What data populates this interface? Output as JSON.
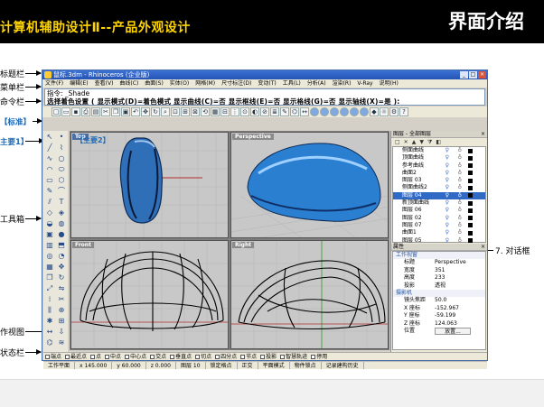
{
  "slide": {
    "header_left": "计算机辅助设计Ⅱ--产品外观设计",
    "header_right": "界面介绍"
  },
  "callouts": {
    "titlebar": "标题栏",
    "menubar": "菜单栏",
    "command": "命令栏",
    "standard": "【标准】",
    "main1": "主要1】",
    "main2": "【主要2】",
    "toolbox": "工具箱",
    "workview": "作视图",
    "statusbar": "状态栏",
    "dialog": "7.  对话框"
  },
  "app": {
    "title": "鼠标.3dm - Rhinoceros (企业版)",
    "menu": [
      "文件(F)",
      "编辑(E)",
      "查看(V)",
      "曲线(C)",
      "曲面(S)",
      "实体(O)",
      "网格(M)",
      "尺寸标注(D)",
      "变动(T)",
      "工具(L)",
      "分析(A)",
      "渲染(R)",
      "V-Ray",
      "说明(H)"
    ],
    "command_line1": "指令: _Shade",
    "command_line2": "选择着色设置 ( 显示模式(D)=着色模式  显示曲线(C)=否  显示框线(E)=否  显示格线(G)=否  显示轴线(X)=是 ):"
  },
  "viewports": {
    "top": "Top",
    "perspective": "Perspective",
    "front": "Front",
    "right": "Right"
  },
  "layers_panel": {
    "title": "图层 - 全部图层",
    "layers": [
      "侧面曲线",
      "顶面曲线",
      "参考曲线",
      "曲面2",
      "图层 03",
      "侧面曲线2",
      "图层 04",
      "新顶面曲线",
      "图层 06",
      "图层 02",
      "图层 07",
      "曲面1",
      "图层 05"
    ],
    "selected_index": 6
  },
  "properties_panel": {
    "title": "属性",
    "section1": "工作视窗",
    "rows1": [
      {
        "label": "标题",
        "value": "Perspective"
      },
      {
        "label": "宽度",
        "value": "351"
      },
      {
        "label": "高度",
        "value": "233"
      },
      {
        "label": "投影",
        "value": "透视"
      }
    ],
    "section2": "摄影机",
    "rows2": [
      {
        "label": "镜头焦距",
        "value": "50.0"
      },
      {
        "label": "X 座标",
        "value": "-152.967"
      },
      {
        "label": "Y 座标",
        "value": "-59.199"
      },
      {
        "label": "Z 座标",
        "value": "124.063"
      },
      {
        "label": "位置",
        "value": "放置..."
      }
    ]
  },
  "osnap": [
    "端点",
    "最近点",
    "点",
    "中点",
    "中心点",
    "交点",
    "垂直点",
    "切点",
    "四分点",
    "节点",
    "投影",
    "智慧轨迹",
    "停用"
  ],
  "statusbar": [
    "工作平面",
    "x 145.000",
    "y 60.000",
    "z 0.000",
    "图层 10",
    "锁定格点",
    "正交",
    "平面模式",
    "物件锁点",
    "记录建构历史"
  ]
}
